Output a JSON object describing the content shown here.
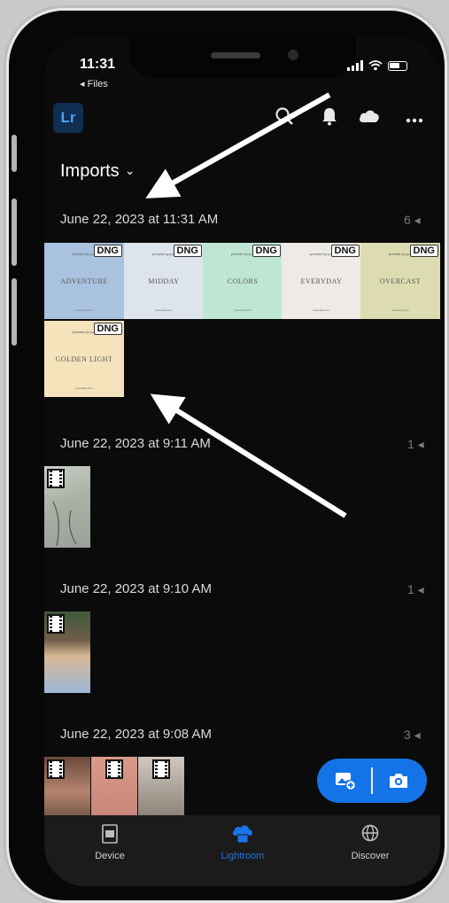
{
  "status": {
    "time": "11:31",
    "back_label": "◂ Files"
  },
  "app": {
    "logo_text": "Lr"
  },
  "header": {
    "title": "Imports"
  },
  "groups": [
    {
      "date": "June 22, 2023 at 11:31 AM",
      "count": "6"
    },
    {
      "date": "June 22, 2023 at 9:11 AM",
      "count": "1"
    },
    {
      "date": "June 22, 2023 at 9:10 AM",
      "count": "1"
    },
    {
      "date": "June 22, 2023 at 9:08 AM",
      "count": "3"
    }
  ],
  "presets": [
    {
      "name": "ADVENTURE",
      "badge": "DNG",
      "color": "#a9c2df"
    },
    {
      "name": "MIDDAY",
      "badge": "DNG",
      "color": "#dde4ee"
    },
    {
      "name": "COLORS",
      "badge": "DNG",
      "color": "#bfe6d4"
    },
    {
      "name": "EVERYDAY",
      "badge": "DNG",
      "color": "#eeebe6"
    },
    {
      "name": "OVERCAST",
      "badge": "DNG",
      "color": "#dcdcb0"
    },
    {
      "name": "GOLDEN LIGHT",
      "badge": "DNG",
      "color": "#f4e3bb"
    }
  ],
  "tabs": [
    {
      "label": "Device",
      "icon": "device-icon"
    },
    {
      "label": "Lightroom",
      "icon": "lightroom-cloud-icon"
    },
    {
      "label": "Discover",
      "icon": "globe-icon"
    }
  ],
  "colors": {
    "accent": "#1473e6",
    "lr_blue": "#4aa3ff",
    "background": "#0b0b0b"
  }
}
